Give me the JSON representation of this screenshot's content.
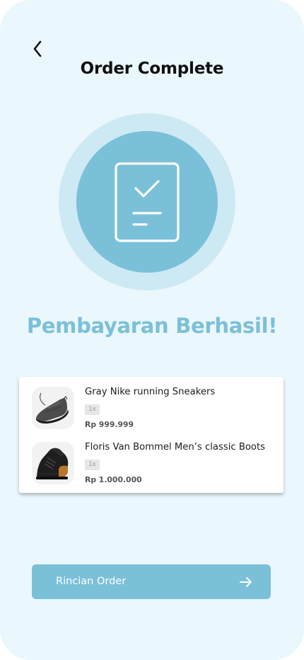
{
  "header": {
    "title": "Order Complete",
    "back_icon": "chevron-left-icon"
  },
  "hero": {
    "icon": "checklist-document-icon",
    "outer_color": "#cde9f3",
    "inner_color": "#7bc0d9"
  },
  "status": {
    "message": "Pembayaran Berhasil!"
  },
  "order": {
    "items": [
      {
        "name": "Gray Nike running Sneakers",
        "quantity": "1x",
        "price": "Rp 999.999",
        "image": "sneaker-image"
      },
      {
        "name": "Floris Van Bommel Men’s classic Boots",
        "quantity": "1x",
        "price": "Rp 1.000.000",
        "image": "boot-image"
      }
    ]
  },
  "action": {
    "label": "Rincian Order",
    "icon": "arrow-right-icon",
    "color": "#7bc0d9"
  },
  "colors": {
    "background": "#eaf7fc",
    "accent": "#7bc0d9"
  }
}
